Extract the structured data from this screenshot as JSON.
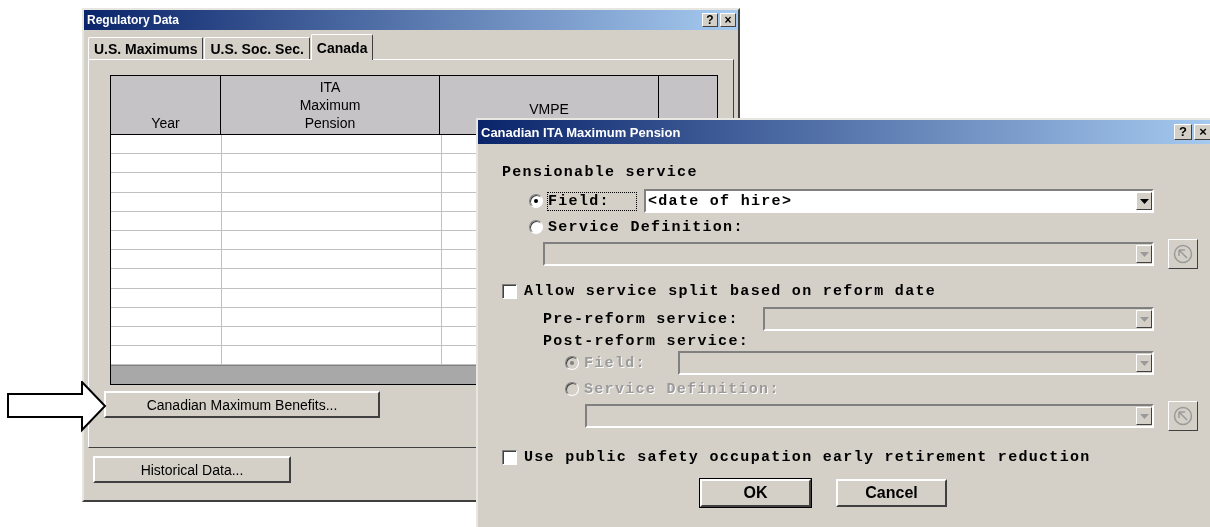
{
  "main_window": {
    "title": "Regulatory Data",
    "help_button": "?",
    "close_button": "×",
    "tabs": [
      {
        "label": "U.S. Maximums",
        "selected": false
      },
      {
        "label": "U.S. Soc. Sec.",
        "selected": false
      },
      {
        "label": "Canada",
        "selected": true
      }
    ],
    "table": {
      "columns": [
        [
          "Year"
        ],
        [
          "ITA",
          "Maximum",
          "Pension"
        ],
        [
          "VMPE"
        ]
      ]
    },
    "buttons": [
      {
        "label": "Canadian Maximum Benefits..."
      },
      {
        "label": "Historical Data..."
      }
    ]
  },
  "dialog": {
    "title": "Canadian ITA Maximum Pension",
    "help_button": "?",
    "close_button": "×",
    "pensionable_service": {
      "label": "Pensionable service",
      "options": [
        {
          "label": "Field:",
          "selected": true,
          "disabled": false
        },
        {
          "label": "Service Definition:",
          "selected": false,
          "disabled": false
        }
      ],
      "field_dropdown": {
        "value": "<date of hire>",
        "disabled": false
      },
      "definition_dropdown": {
        "disabled": true
      }
    },
    "reform_split": {
      "label": "Allow service split based on reform date",
      "checked": false,
      "pre_label": "Pre-reform service:",
      "post_label": "Post-reform service:",
      "options": [
        {
          "label": "Field:",
          "selected": true,
          "disabled": true
        },
        {
          "label": "Service Definition:",
          "selected": false,
          "disabled": true
        }
      ]
    },
    "public_safety": {
      "label": "Use public safety occupation early retirement reduction",
      "checked": false
    },
    "buttons": [
      {
        "label": "OK",
        "default": true
      },
      {
        "label": "Cancel",
        "default": false
      }
    ]
  }
}
